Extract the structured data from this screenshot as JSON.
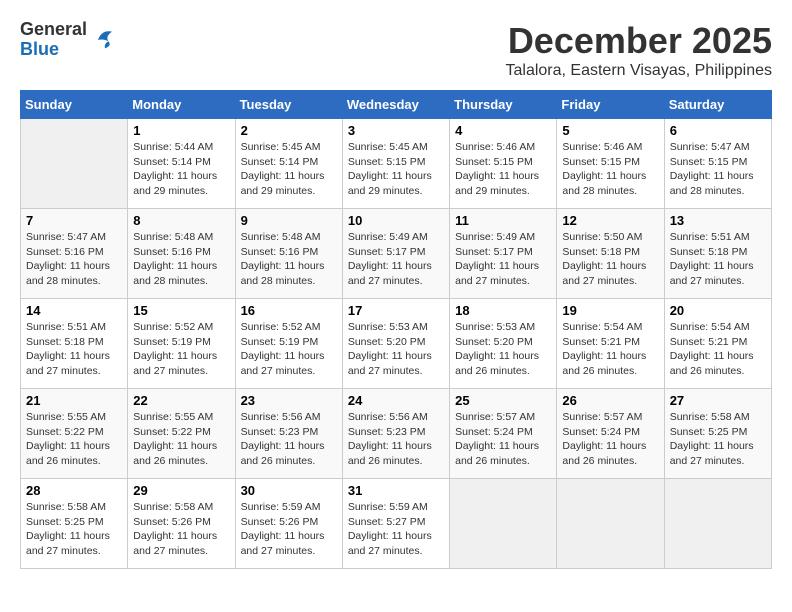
{
  "header": {
    "logo_general": "General",
    "logo_blue": "Blue",
    "month_year": "December 2025",
    "location": "Talalora, Eastern Visayas, Philippines"
  },
  "calendar": {
    "days_of_week": [
      "Sunday",
      "Monday",
      "Tuesday",
      "Wednesday",
      "Thursday",
      "Friday",
      "Saturday"
    ],
    "weeks": [
      [
        {
          "day": "",
          "sunrise": "",
          "sunset": "",
          "daylight": "",
          "empty": true
        },
        {
          "day": "1",
          "sunrise": "5:44 AM",
          "sunset": "5:14 PM",
          "daylight": "11 hours and 29 minutes."
        },
        {
          "day": "2",
          "sunrise": "5:45 AM",
          "sunset": "5:14 PM",
          "daylight": "11 hours and 29 minutes."
        },
        {
          "day": "3",
          "sunrise": "5:45 AM",
          "sunset": "5:15 PM",
          "daylight": "11 hours and 29 minutes."
        },
        {
          "day": "4",
          "sunrise": "5:46 AM",
          "sunset": "5:15 PM",
          "daylight": "11 hours and 29 minutes."
        },
        {
          "day": "5",
          "sunrise": "5:46 AM",
          "sunset": "5:15 PM",
          "daylight": "11 hours and 28 minutes."
        },
        {
          "day": "6",
          "sunrise": "5:47 AM",
          "sunset": "5:15 PM",
          "daylight": "11 hours and 28 minutes."
        }
      ],
      [
        {
          "day": "7",
          "sunrise": "5:47 AM",
          "sunset": "5:16 PM",
          "daylight": "11 hours and 28 minutes."
        },
        {
          "day": "8",
          "sunrise": "5:48 AM",
          "sunset": "5:16 PM",
          "daylight": "11 hours and 28 minutes."
        },
        {
          "day": "9",
          "sunrise": "5:48 AM",
          "sunset": "5:16 PM",
          "daylight": "11 hours and 28 minutes."
        },
        {
          "day": "10",
          "sunrise": "5:49 AM",
          "sunset": "5:17 PM",
          "daylight": "11 hours and 27 minutes."
        },
        {
          "day": "11",
          "sunrise": "5:49 AM",
          "sunset": "5:17 PM",
          "daylight": "11 hours and 27 minutes."
        },
        {
          "day": "12",
          "sunrise": "5:50 AM",
          "sunset": "5:18 PM",
          "daylight": "11 hours and 27 minutes."
        },
        {
          "day": "13",
          "sunrise": "5:51 AM",
          "sunset": "5:18 PM",
          "daylight": "11 hours and 27 minutes."
        }
      ],
      [
        {
          "day": "14",
          "sunrise": "5:51 AM",
          "sunset": "5:18 PM",
          "daylight": "11 hours and 27 minutes."
        },
        {
          "day": "15",
          "sunrise": "5:52 AM",
          "sunset": "5:19 PM",
          "daylight": "11 hours and 27 minutes."
        },
        {
          "day": "16",
          "sunrise": "5:52 AM",
          "sunset": "5:19 PM",
          "daylight": "11 hours and 27 minutes."
        },
        {
          "day": "17",
          "sunrise": "5:53 AM",
          "sunset": "5:20 PM",
          "daylight": "11 hours and 27 minutes."
        },
        {
          "day": "18",
          "sunrise": "5:53 AM",
          "sunset": "5:20 PM",
          "daylight": "11 hours and 26 minutes."
        },
        {
          "day": "19",
          "sunrise": "5:54 AM",
          "sunset": "5:21 PM",
          "daylight": "11 hours and 26 minutes."
        },
        {
          "day": "20",
          "sunrise": "5:54 AM",
          "sunset": "5:21 PM",
          "daylight": "11 hours and 26 minutes."
        }
      ],
      [
        {
          "day": "21",
          "sunrise": "5:55 AM",
          "sunset": "5:22 PM",
          "daylight": "11 hours and 26 minutes."
        },
        {
          "day": "22",
          "sunrise": "5:55 AM",
          "sunset": "5:22 PM",
          "daylight": "11 hours and 26 minutes."
        },
        {
          "day": "23",
          "sunrise": "5:56 AM",
          "sunset": "5:23 PM",
          "daylight": "11 hours and 26 minutes."
        },
        {
          "day": "24",
          "sunrise": "5:56 AM",
          "sunset": "5:23 PM",
          "daylight": "11 hours and 26 minutes."
        },
        {
          "day": "25",
          "sunrise": "5:57 AM",
          "sunset": "5:24 PM",
          "daylight": "11 hours and 26 minutes."
        },
        {
          "day": "26",
          "sunrise": "5:57 AM",
          "sunset": "5:24 PM",
          "daylight": "11 hours and 26 minutes."
        },
        {
          "day": "27",
          "sunrise": "5:58 AM",
          "sunset": "5:25 PM",
          "daylight": "11 hours and 27 minutes."
        }
      ],
      [
        {
          "day": "28",
          "sunrise": "5:58 AM",
          "sunset": "5:25 PM",
          "daylight": "11 hours and 27 minutes."
        },
        {
          "day": "29",
          "sunrise": "5:58 AM",
          "sunset": "5:26 PM",
          "daylight": "11 hours and 27 minutes."
        },
        {
          "day": "30",
          "sunrise": "5:59 AM",
          "sunset": "5:26 PM",
          "daylight": "11 hours and 27 minutes."
        },
        {
          "day": "31",
          "sunrise": "5:59 AM",
          "sunset": "5:27 PM",
          "daylight": "11 hours and 27 minutes."
        },
        {
          "day": "",
          "sunrise": "",
          "sunset": "",
          "daylight": "",
          "empty": true
        },
        {
          "day": "",
          "sunrise": "",
          "sunset": "",
          "daylight": "",
          "empty": true
        },
        {
          "day": "",
          "sunrise": "",
          "sunset": "",
          "daylight": "",
          "empty": true
        }
      ]
    ]
  }
}
